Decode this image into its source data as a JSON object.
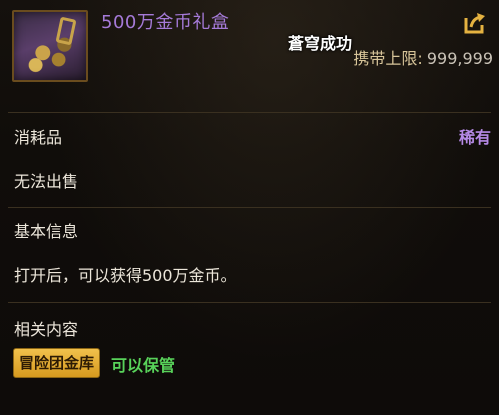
{
  "item": {
    "name": "500万金币礼盒",
    "icon": "gold-gift-box-icon"
  },
  "toast": "蒼穹成功",
  "currency_limit": {
    "label": "携带上限:",
    "value": "999,999"
  },
  "category": {
    "type": "消耗品",
    "rarity": "稀有",
    "rarity_color": "#b68ae6"
  },
  "trade": "无法出售",
  "basic_info": {
    "heading": "基本信息",
    "description": "打开后，可以获得500万金币。"
  },
  "related": {
    "heading": "相关内容",
    "badge": "冒险团金库",
    "badge_color": "#f1c14c",
    "storage": "可以保管",
    "storage_color": "#58d25a"
  }
}
